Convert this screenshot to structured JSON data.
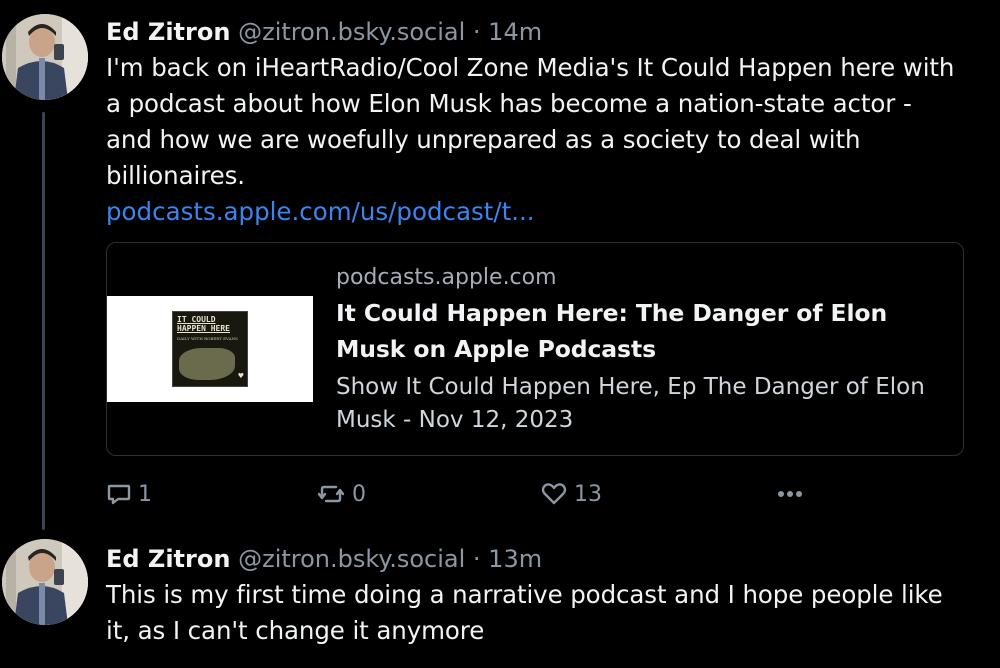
{
  "posts": [
    {
      "author": {
        "display_name": "Ed Zitron",
        "handle": "@zitron.bsky.social"
      },
      "separator": "·",
      "time": "14m",
      "text": "I'm back on iHeartRadio/Cool Zone Media's It Could Happen here with a podcast about how Elon Musk has become a nation-state actor - and how we are woefully unprepared as a society to deal with billionaires.",
      "link_text": "podcasts.apple.com/us/podcast/t...",
      "embed": {
        "cover_title": "IT COULD HAPPEN HERE",
        "cover_subtitle": "DAILY WITH ROBERT EVANS",
        "domain": "podcasts.apple.com",
        "title": "It Could Happen Here: The Danger of Elon Musk on Apple Podcasts",
        "description": "Show It Could Happen Here, Ep The Danger of Elon Musk - Nov 12, 2023"
      },
      "actions": {
        "reply_icon": "speech-bubble-icon",
        "reply_count": "1",
        "repost_icon": "repost-arrows-icon",
        "repost_count": "0",
        "like_icon": "heart-icon",
        "like_count": "13",
        "more_icon": "ellipsis-icon"
      }
    },
    {
      "author": {
        "display_name": "Ed Zitron",
        "handle": "@zitron.bsky.social"
      },
      "separator": "·",
      "time": "13m",
      "text": "This is my first time doing a narrative podcast and I hope people like it, as I can't change it anymore"
    }
  ],
  "colors": {
    "background": "#000000",
    "text": "#f1f3f5",
    "muted": "#8c97a4",
    "link": "#3c84ef",
    "thread_line": "#3b4450"
  }
}
